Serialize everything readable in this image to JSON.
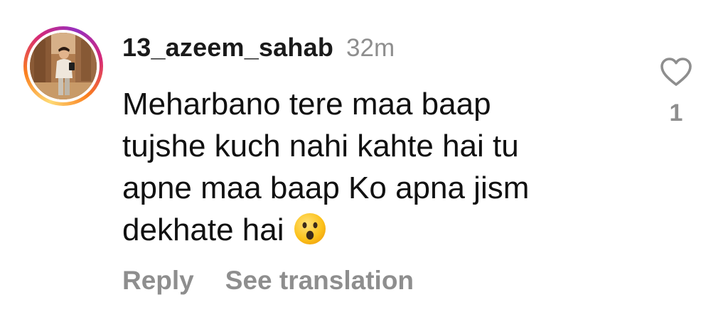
{
  "comment": {
    "username": "13_azeem_sahab",
    "time": "32m",
    "lines": [
      "Meharbano tere maa baap",
      "tujshe kuch nahi kahte hai tu",
      "apne maa baap Ko apna jism",
      "dekhate hai"
    ],
    "emoji": "face-with-open-mouth-emoji"
  },
  "actions": {
    "reply_label": "Reply",
    "see_translation_label": "See translation"
  },
  "likes": {
    "icon": "heart-outline-icon",
    "count": "1"
  },
  "colors": {
    "text": "#111111",
    "muted": "#8e8e8e",
    "ring_gradient": [
      "#feda75",
      "#fa7e1e",
      "#d62976",
      "#962fbf"
    ]
  }
}
